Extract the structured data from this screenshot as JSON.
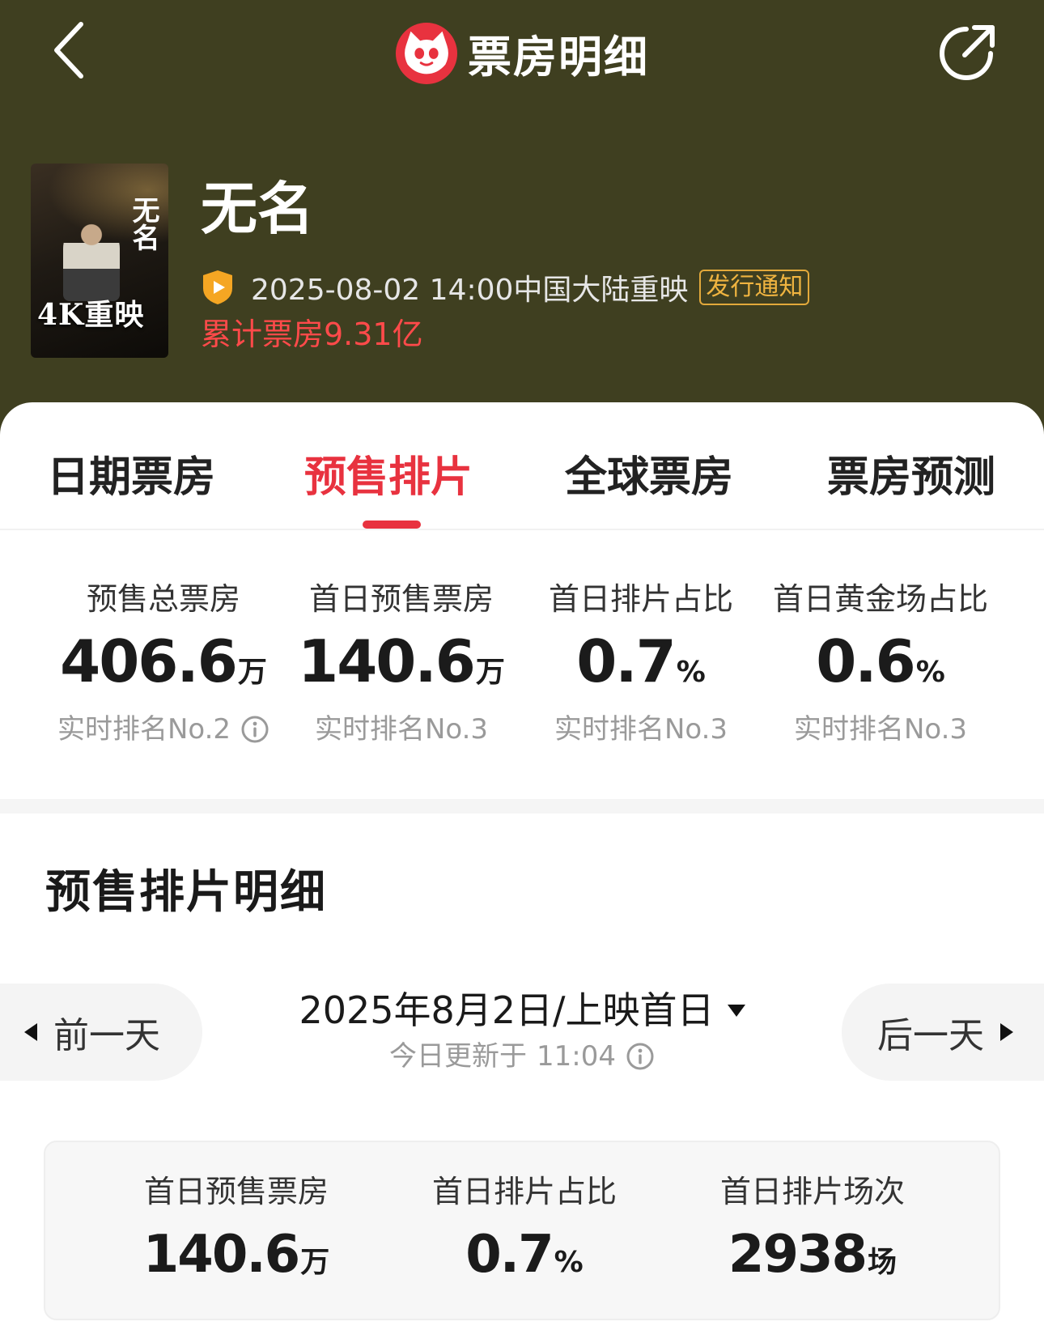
{
  "header": {
    "title": "票房明细",
    "back_icon": "chevron-left-icon",
    "share_icon": "share-icon",
    "logo_icon": "cat-logo-icon",
    "logo_color": "#e8323f",
    "background": "#3f3f20"
  },
  "movie": {
    "poster_title": "无名",
    "poster_tag": "4K重映",
    "name": "无名",
    "release": "2025-08-02 14:00中国大陆重映",
    "notice_tag": "发行通知",
    "cumulative": "累计票房9.31亿"
  },
  "tabs": [
    {
      "label": "日期票房",
      "active": false
    },
    {
      "label": "预售排片",
      "active": true
    },
    {
      "label": "全球票房",
      "active": false
    },
    {
      "label": "票房预测",
      "active": false
    }
  ],
  "stats": [
    {
      "label": "预售总票房",
      "value": "406.6",
      "unit": "万",
      "rank": "实时排名No.2",
      "has_info": true
    },
    {
      "label": "首日预售票房",
      "value": "140.6",
      "unit": "万",
      "rank": "实时排名No.3",
      "has_info": false
    },
    {
      "label": "首日排片占比",
      "value": "0.7",
      "unit": "%",
      "rank": "实时排名No.3",
      "has_info": false
    },
    {
      "label": "首日黄金场占比",
      "value": "0.6",
      "unit": "%",
      "rank": "实时排名No.3",
      "has_info": false
    }
  ],
  "section": {
    "title": "预售排片明细"
  },
  "date_nav": {
    "prev": "前一天",
    "next": "后一天",
    "date": "2025年8月2日/上映首日",
    "updated_label": "今日更新于",
    "updated_time": "11:04"
  },
  "summary": [
    {
      "label": "首日预售票房",
      "value": "140.6",
      "unit": "万"
    },
    {
      "label": "首日排片占比",
      "value": "0.7",
      "unit": "%"
    },
    {
      "label": "首日排片场次",
      "value": "2938",
      "unit": "场"
    }
  ],
  "colors": {
    "accent": "#e8323f",
    "cumulative": "#ff4a4a",
    "notice": "#f0b440"
  }
}
